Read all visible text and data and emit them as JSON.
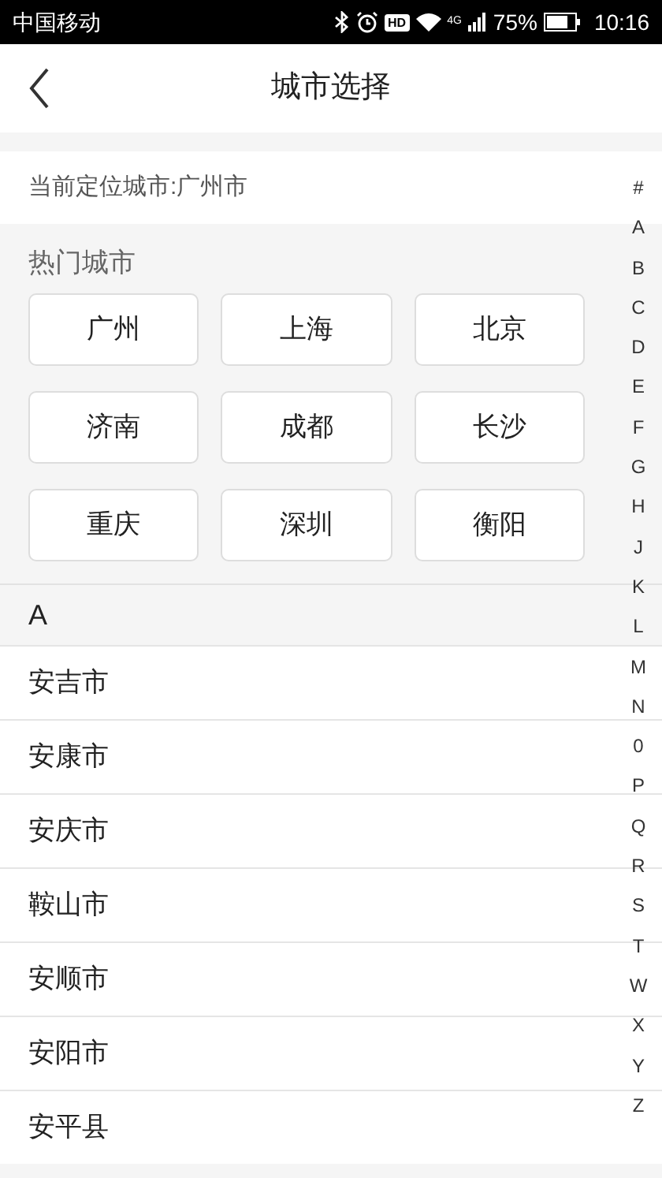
{
  "status_bar": {
    "carrier": "中国移动",
    "hd": "HD",
    "network": "4G",
    "battery": "75%",
    "time": "10:16"
  },
  "header": {
    "title": "城市选择"
  },
  "current_location": "当前定位城市:广州市",
  "hot_cities": {
    "title": "热门城市",
    "items": [
      "广州",
      "上海",
      "北京",
      "济南",
      "成都",
      "长沙",
      "重庆",
      "深圳",
      "衡阳"
    ]
  },
  "sections": [
    {
      "letter": "A",
      "cities": [
        "安吉市",
        "安康市",
        "安庆市",
        "鞍山市",
        "安顺市",
        "安阳市",
        "安平县"
      ]
    }
  ],
  "index_bar": [
    "#",
    "A",
    "B",
    "C",
    "D",
    "E",
    "F",
    "G",
    "H",
    "J",
    "K",
    "L",
    "M",
    "N",
    "0",
    "P",
    "Q",
    "R",
    "S",
    "T",
    "W",
    "X",
    "Y",
    "Z"
  ]
}
